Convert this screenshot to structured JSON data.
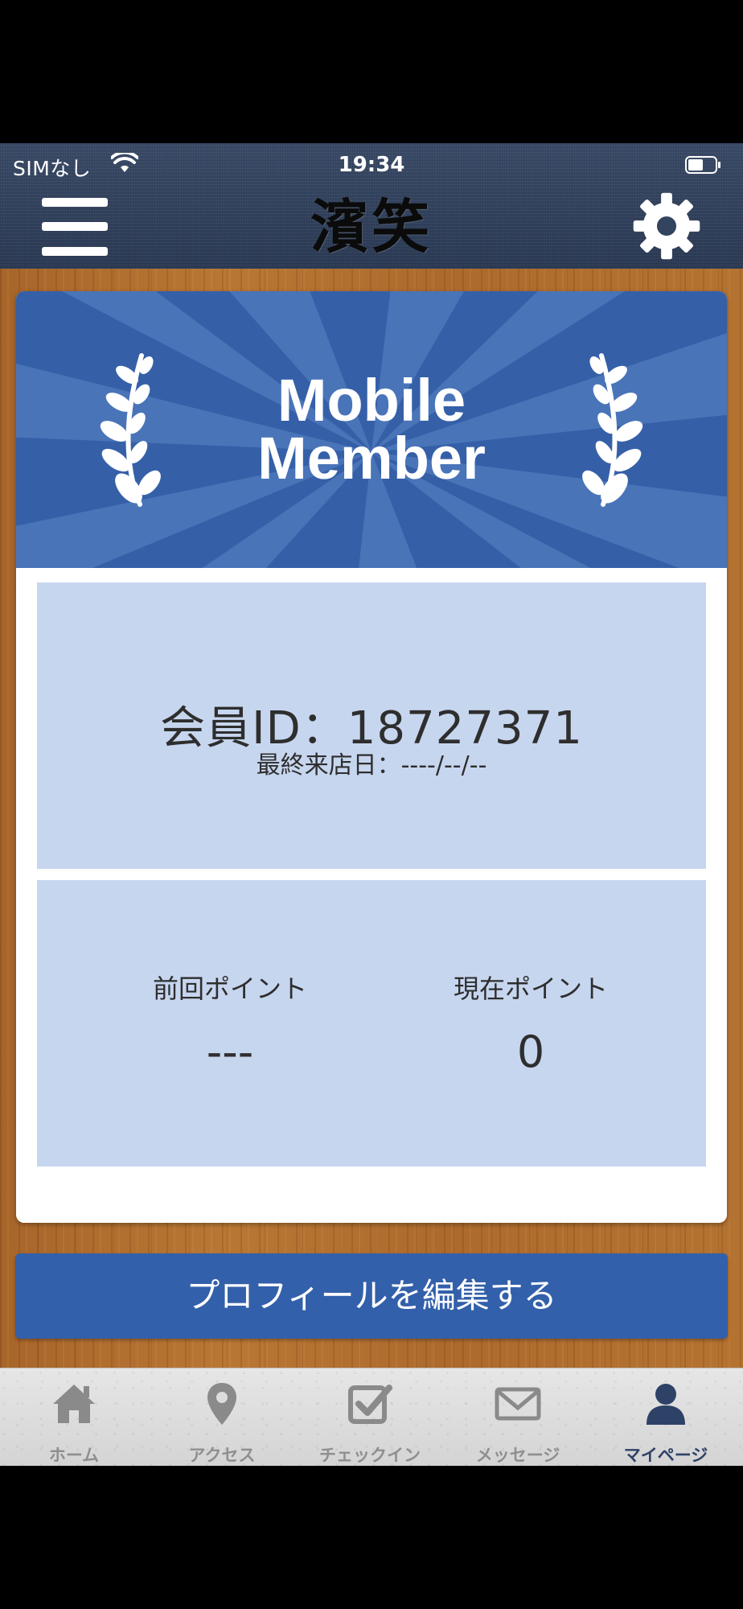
{
  "status_bar": {
    "carrier": "SIMなし",
    "time": "19:34"
  },
  "header": {
    "logo_text": "濱笑"
  },
  "banner": {
    "line1": "Mobile",
    "line2": "Member"
  },
  "member": {
    "id_label": "会員ID：",
    "id_value": "18727371",
    "last_visit_label": "最終来店日：",
    "last_visit_value": "----/--/--"
  },
  "points": {
    "previous_label": "前回ポイント",
    "previous_value": "---",
    "current_label": "現在ポイント",
    "current_value": "0"
  },
  "edit_profile_label": "プロフィールを編集する",
  "tabs": [
    {
      "label": "ホーム",
      "icon": "home-icon"
    },
    {
      "label": "アクセス",
      "icon": "map-pin-icon"
    },
    {
      "label": "チェックイン",
      "icon": "checkin-icon"
    },
    {
      "label": "メッセージ",
      "icon": "mail-icon"
    },
    {
      "label": "マイページ",
      "icon": "user-icon",
      "active": true
    }
  ],
  "colors": {
    "header": "#33445f",
    "banner": "#3560a8",
    "panel": "#c7d6ef",
    "button": "#3360aa",
    "tab_active": "#2e4268",
    "tab_inactive": "#8f8f8f"
  }
}
